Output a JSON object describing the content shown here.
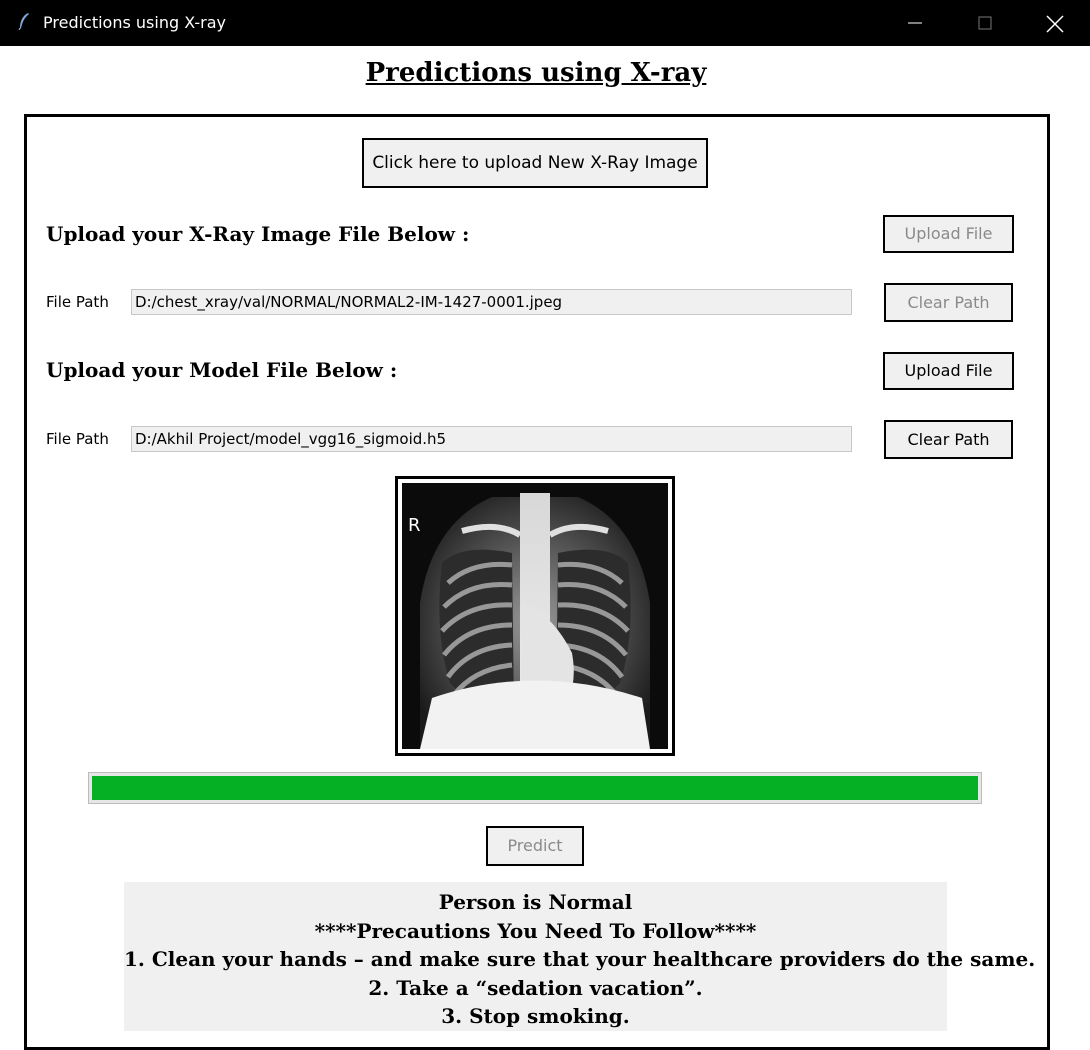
{
  "window": {
    "title": "Predictions using X-ray",
    "app_icon": "feather-icon",
    "controls": [
      "minimize-icon",
      "maximize-icon",
      "close-icon"
    ]
  },
  "heading": "Predictions using X-ray",
  "new_image_button": "Click here to upload New X-Ray Image",
  "xray_section": {
    "label": "Upload your X-Ray Image File Below :",
    "upload_label": "Upload File",
    "upload_enabled": false,
    "path_label": "File Path",
    "path_value": "D:/chest_xray/val/NORMAL/NORMAL2-IM-1427-0001.jpeg",
    "clear_label": "Clear Path",
    "clear_enabled": false
  },
  "model_section": {
    "label": "Upload your Model File Below :",
    "upload_label": "Upload File",
    "upload_enabled": true,
    "path_label": "File Path",
    "path_value": "D:/Akhil Project/model_vgg16_sigmoid.h5",
    "clear_label": "Clear Path",
    "clear_enabled": true
  },
  "xray_marker": "R",
  "progress": {
    "percent": 100,
    "color": "#06b025"
  },
  "predict_button": {
    "label": "Predict",
    "enabled": false
  },
  "result": {
    "status": "Person is Normal",
    "precautions_header": "****Precautions You Need To Follow****",
    "items": [
      "1. Clean your hands – and make sure that your healthcare providers do the same.",
      "2. Take a “sedation vacation”.",
      "3. Stop smoking."
    ]
  }
}
